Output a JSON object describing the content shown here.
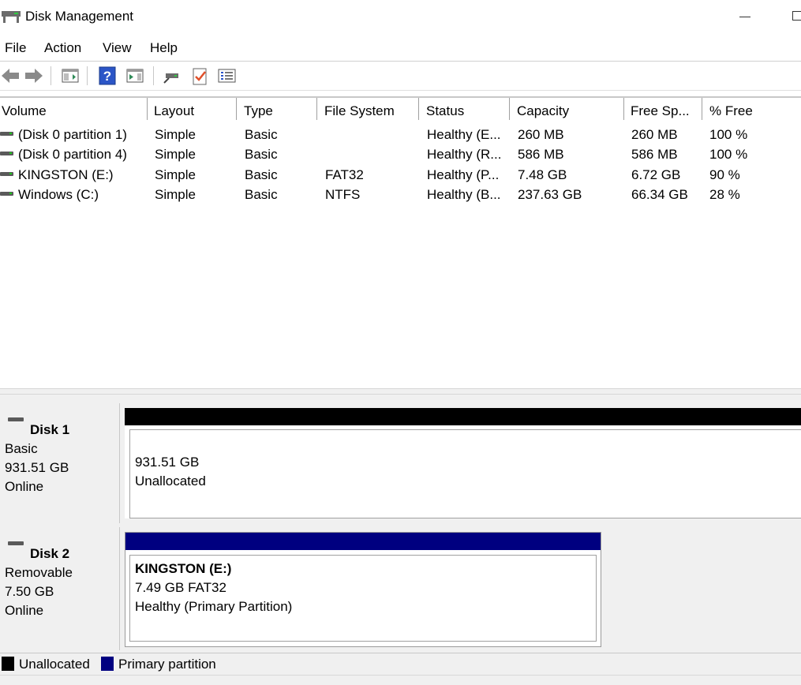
{
  "window": {
    "title": "Disk Management",
    "icon": "disk-management-icon"
  },
  "menu": [
    "File",
    "Action",
    "View",
    "Help"
  ],
  "toolbar": {
    "buttons": [
      "back-icon",
      "forward-icon",
      "console-tree-icon",
      "help-icon",
      "action-pane-icon",
      "connect-icon",
      "properties-icon",
      "list-view-icon"
    ]
  },
  "volumes": {
    "columns": [
      "Volume",
      "Layout",
      "Type",
      "File System",
      "Status",
      "Capacity",
      "Free Sp...",
      "% Free"
    ],
    "rows": [
      [
        "(Disk 0 partition 1)",
        "Simple",
        "Basic",
        "",
        "Healthy (E...",
        "260 MB",
        "260 MB",
        "100 %"
      ],
      [
        "(Disk 0 partition 4)",
        "Simple",
        "Basic",
        "",
        "Healthy (R...",
        "586 MB",
        "586 MB",
        "100 %"
      ],
      [
        "KINGSTON (E:)",
        "Simple",
        "Basic",
        "FAT32",
        "Healthy (P...",
        "7.48 GB",
        "6.72 GB",
        "90 %"
      ],
      [
        "Windows (C:)",
        "Simple",
        "Basic",
        "NTFS",
        "Healthy (B...",
        "237.63 GB",
        "66.34 GB",
        "28 %"
      ]
    ]
  },
  "disks": [
    {
      "name": "Disk 1",
      "type": "Basic",
      "size": "931.51 GB",
      "state": "Online",
      "partition": {
        "size": "931.51 GB",
        "label": "Unallocated",
        "bar_color": "#000000"
      }
    },
    {
      "name": "Disk 2",
      "type": "Removable",
      "size": "7.50 GB",
      "state": "Online",
      "partition": {
        "title": "KINGSTON  (E:)",
        "detail": "7.49 GB FAT32",
        "status": "Healthy (Primary Partition)",
        "bar_color": "#000080"
      }
    }
  ],
  "legend": [
    {
      "label": "Unallocated",
      "color": "#000000"
    },
    {
      "label": "Primary partition",
      "color": "#000080"
    }
  ]
}
